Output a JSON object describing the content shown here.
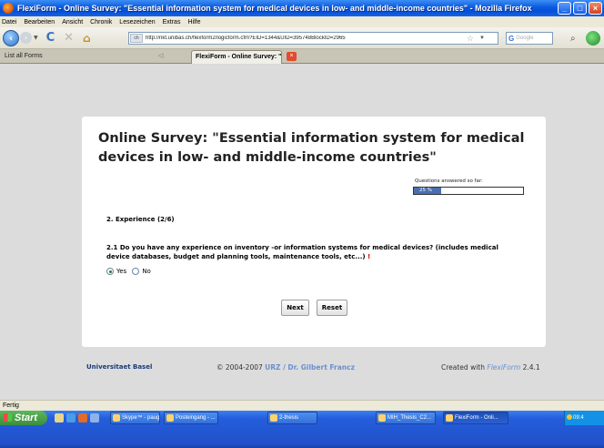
{
  "window": {
    "title": "FlexiForm - Online Survey: \"Essential information system for medical devices in low- and middle-income countries\" - Mozilla Firefox"
  },
  "menu": [
    "Datei",
    "Bearbeiten",
    "Ansicht",
    "Chronik",
    "Lesezeichen",
    "Extras",
    "Hilfe"
  ],
  "toolbar": {
    "url": "http://nkt.unibas.ch/flexform2/logicform.cfm?EID=1344&UID=395748BlockID=2965",
    "site_label": "ch",
    "search_placeholder": "Google",
    "search_engine_letter": "G"
  },
  "tabs": {
    "list_all": "List all Forms",
    "active": "FlexiForm - Online Survey: \"Esse..."
  },
  "survey": {
    "title": "Online Survey: \"Essential information system for medical devices in low- and middle-income countries\"",
    "progress_label": "Questions answered so far:",
    "progress_value": "25 %",
    "progress_fraction": 0.25,
    "section": "2. Experience (2/6)",
    "question": "2.1 Do you have any experience on inventory -or information systems for medical devices? (includes medical device databases, budget and planning tools, maintenance tools, etc...)",
    "required_mark": "!",
    "options": [
      "Yes",
      "No"
    ],
    "selected": "Yes",
    "next_label": "Next",
    "reset_label": "Reset"
  },
  "footer": {
    "university": "Universitaet Basel",
    "copyright_prefix": "© 2004-2007",
    "copyright_link": "URZ / Dr. Gilbert Francz",
    "created_prefix": "Created with",
    "created_brand": "FlexiForm",
    "created_version": "2.4.1"
  },
  "status": "Fertig",
  "taskbar": {
    "start": "Start",
    "tasks": [
      "Skype™ - paug...",
      "Posteingang - ...",
      "2-thesis",
      "MIH_Thesis_C2...",
      "FlexiForm - Onli..."
    ],
    "clock": "09:4"
  }
}
